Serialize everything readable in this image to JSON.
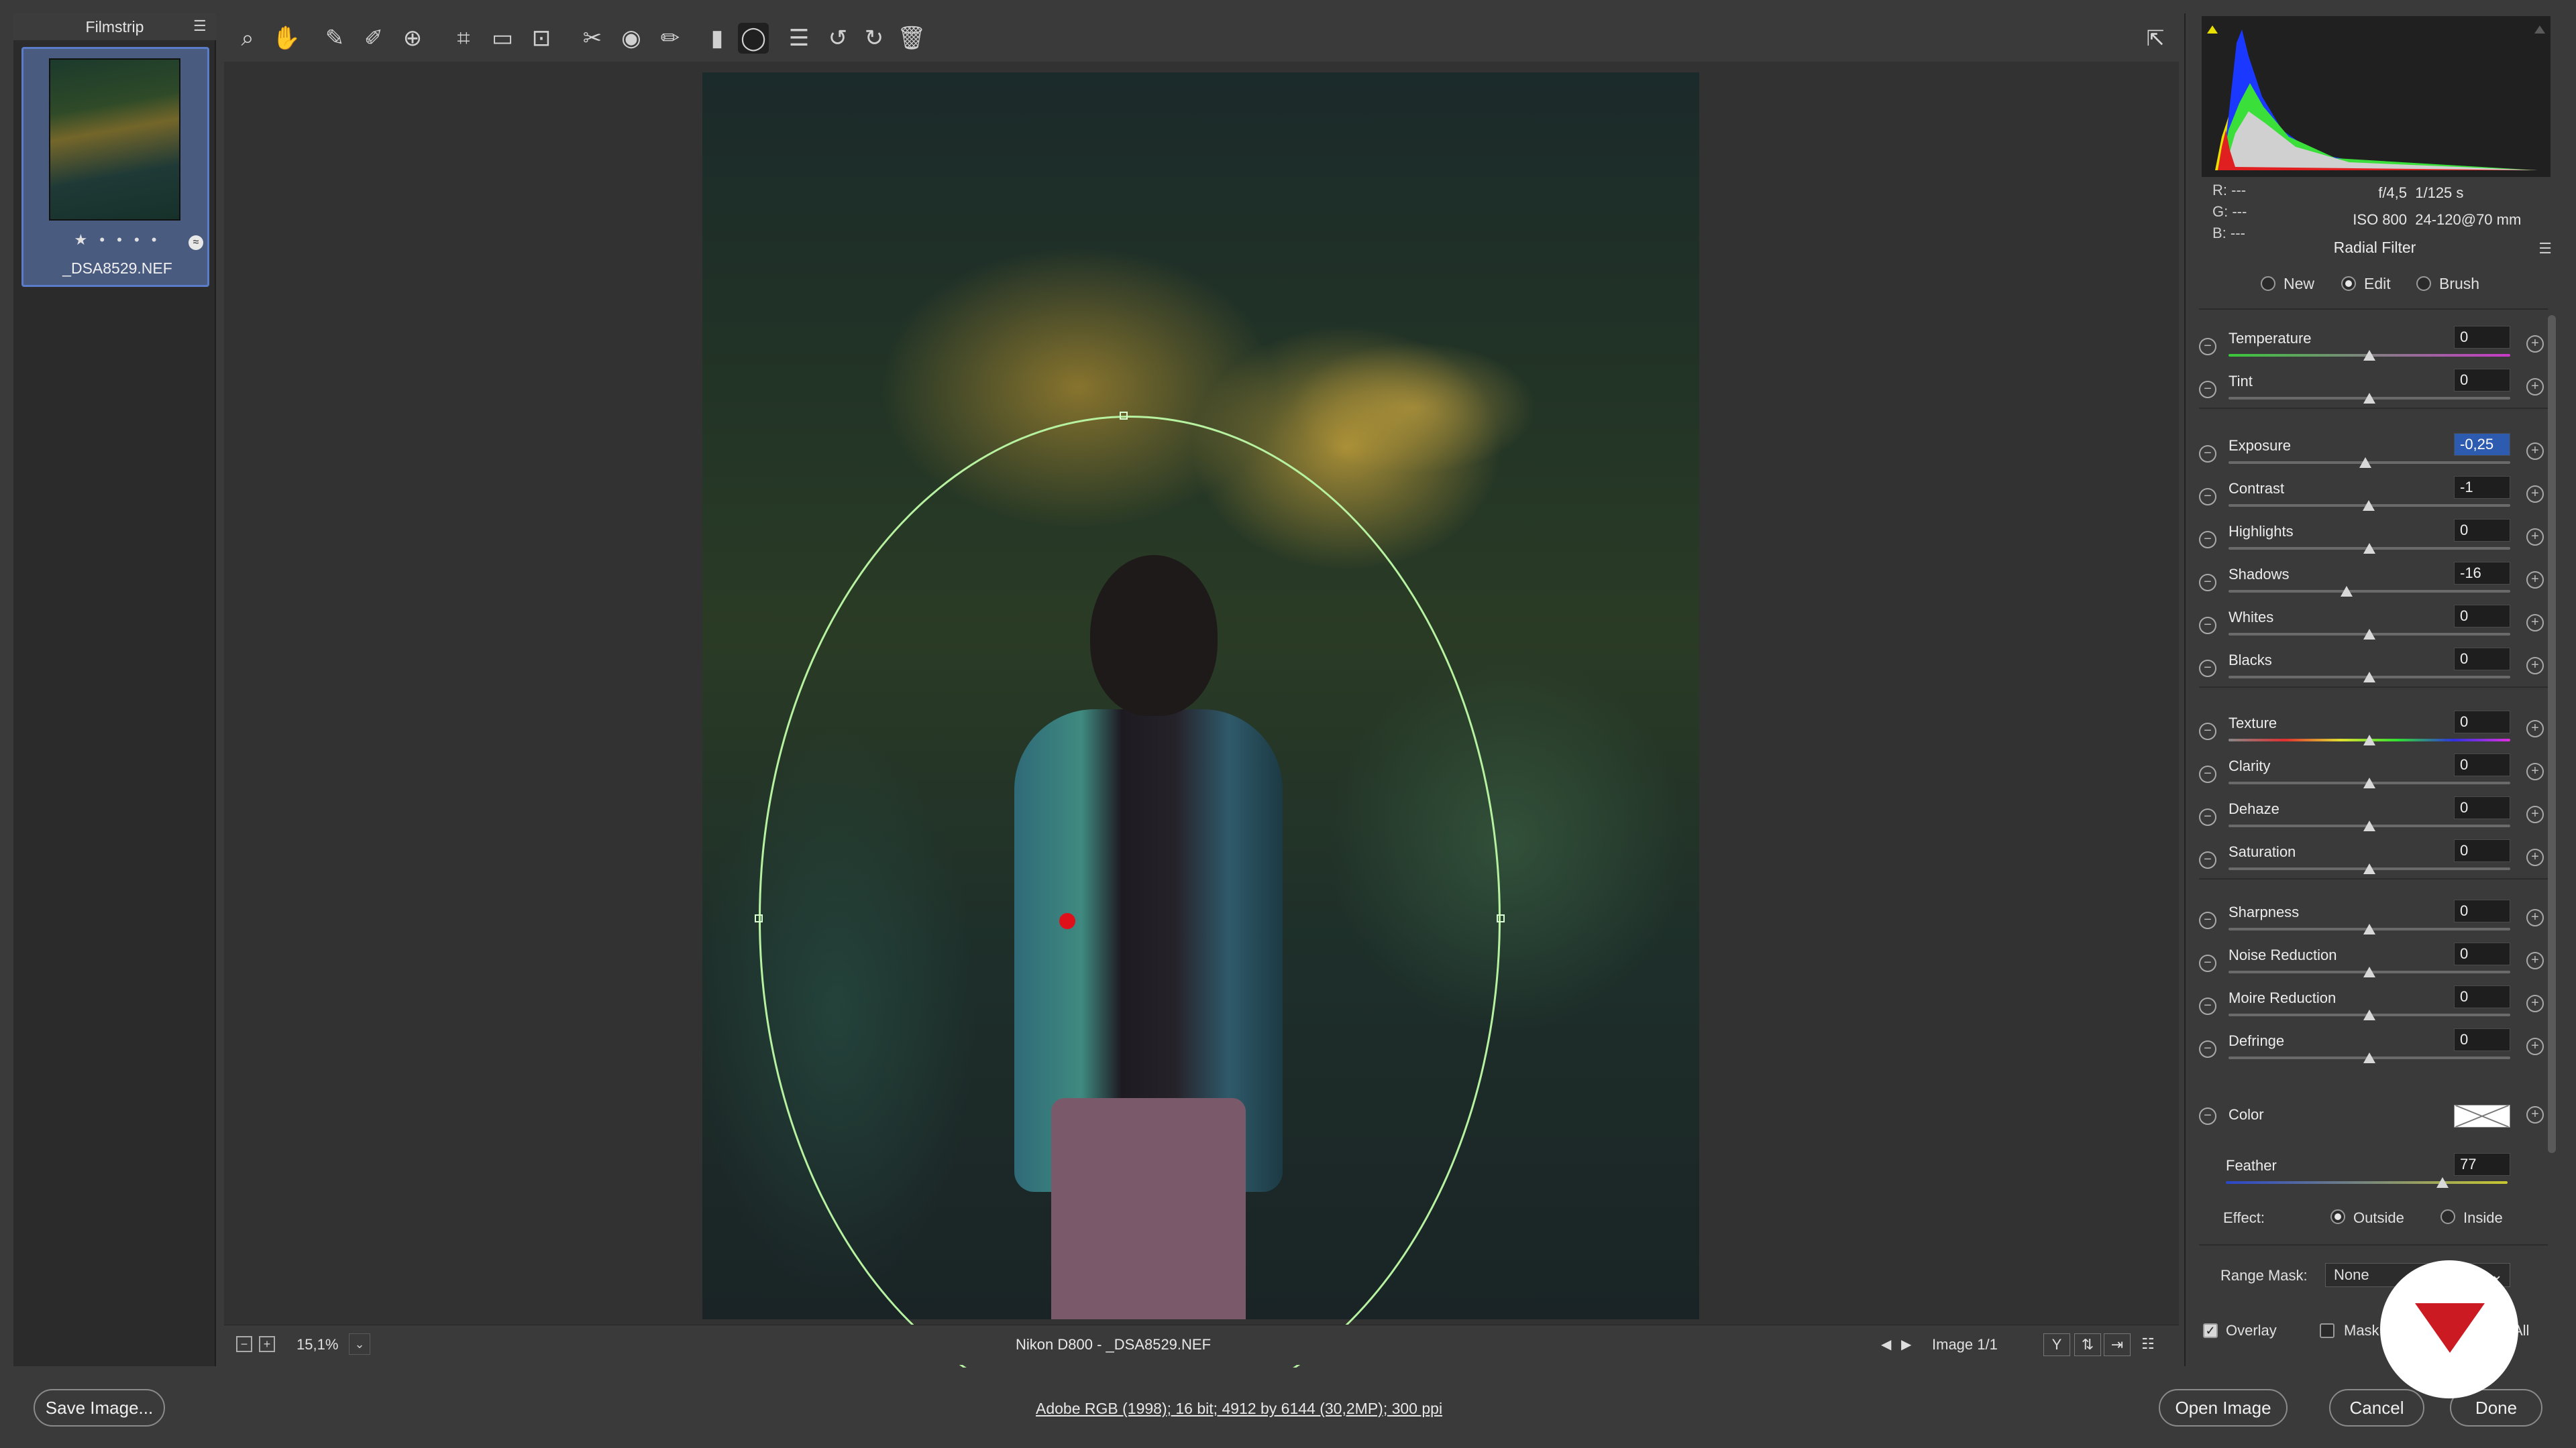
{
  "filmstrip": {
    "title": "Filmstrip",
    "items": [
      {
        "filename": "_DSA8529.NEF",
        "rating": "★ • • • •"
      }
    ]
  },
  "toolbar": {
    "tools": [
      "zoom-icon",
      "hand-icon",
      "white-balance-icon",
      "color-sampler-icon",
      "targeted-adjustment-icon",
      "crop-icon",
      "straighten-icon",
      "transform-icon",
      "spot-removal-icon",
      "red-eye-icon",
      "adjustment-brush-icon",
      "graduated-filter-icon",
      "radial-filter-icon",
      "presets-icon",
      "rotate-left-icon",
      "rotate-right-icon",
      "trash-icon"
    ]
  },
  "status": {
    "zoom": "15,1%",
    "caption": "Nikon D800  -  _DSA8529.NEF",
    "image_count": "Image 1/1"
  },
  "info": {
    "r_label": "R:",
    "r_value": "---",
    "g_label": "G:",
    "g_value": "---",
    "b_label": "B:",
    "b_value": "---",
    "aperture": "f/4,5",
    "shutter": "1/125 s",
    "iso": "ISO 800",
    "lens": "24-120@70 mm"
  },
  "panel": {
    "title": "Radial Filter",
    "modes": [
      "New",
      "Edit",
      "Brush"
    ],
    "active_mode": "Edit",
    "groups": [
      [
        {
          "label": "Temperature",
          "value": "0",
          "pos": 0.5
        },
        {
          "label": "Tint",
          "value": "0",
          "pos": 0.5
        }
      ],
      [
        {
          "label": "Exposure",
          "value": "-0,25",
          "pos": 0.485,
          "selected": true
        },
        {
          "label": "Contrast",
          "value": "-1",
          "pos": 0.497
        },
        {
          "label": "Highlights",
          "value": "0",
          "pos": 0.5
        },
        {
          "label": "Shadows",
          "value": "-16",
          "pos": 0.42
        },
        {
          "label": "Whites",
          "value": "0",
          "pos": 0.5
        },
        {
          "label": "Blacks",
          "value": "0",
          "pos": 0.5
        }
      ],
      [
        {
          "label": "Texture",
          "value": "0",
          "pos": 0.5
        },
        {
          "label": "Clarity",
          "value": "0",
          "pos": 0.5
        },
        {
          "label": "Dehaze",
          "value": "0",
          "pos": 0.5
        },
        {
          "label": "Saturation",
          "value": "0",
          "pos": 0.5
        }
      ],
      [
        {
          "label": "Sharpness",
          "value": "0",
          "pos": 0.5
        },
        {
          "label": "Noise Reduction",
          "value": "0",
          "pos": 0.5
        },
        {
          "label": "Moire Reduction",
          "value": "0",
          "pos": 0.5
        },
        {
          "label": "Defringe",
          "value": "0",
          "pos": 0.5
        }
      ]
    ],
    "color_label": "Color",
    "feather_label": "Feather",
    "feather_value": "77",
    "feather_pos": 0.77,
    "effect_label": "Effect:",
    "effect_outside": "Outside",
    "effect_inside": "Inside",
    "range_mask_label": "Range Mask:",
    "range_mask_value": "None",
    "overlay_label": "Overlay",
    "mask_label": "Mask",
    "clear_all_label": "All"
  },
  "bottom": {
    "save_label": "Save Image...",
    "workflow": "Adobe RGB (1998); 16 bit; 4912 by 6144 (30,2MP); 300 ppi",
    "open_label": "Open Image",
    "cancel_label": "Cancel",
    "done_label": "Done"
  },
  "colors": {
    "accent": "#2d5bb0",
    "mask_outline": "#b6f2a0",
    "pin": "#e0101a",
    "logo": "#cc1a22"
  }
}
